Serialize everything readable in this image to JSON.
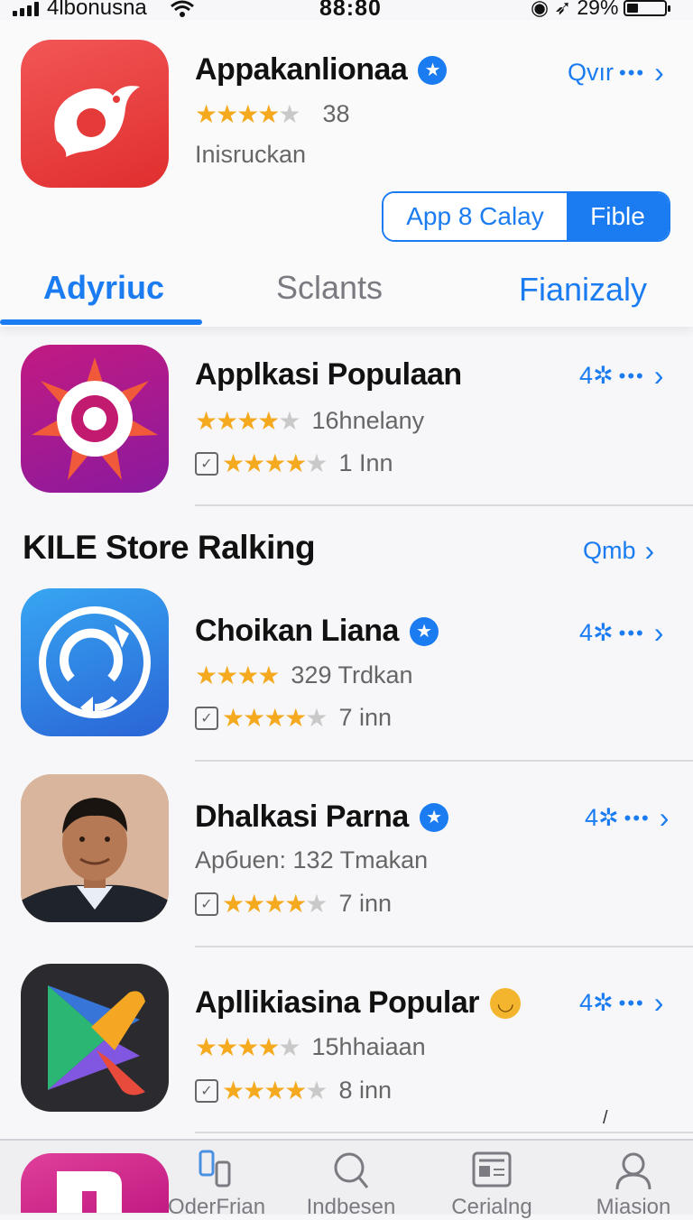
{
  "status_bar": {
    "carrier": "4lbonusna",
    "time": "88:80",
    "battery": "29%",
    "battery_level": 0.29
  },
  "featured_app": {
    "name": "Appakanlionaa",
    "rating_count": "38",
    "category": "Inisruckan",
    "more_label": "Qvır",
    "icon": "bird-logo-icon",
    "icon_color": "#ea3b3b",
    "segment": {
      "left_label": "App 8 Calay",
      "right_label": "Fible"
    }
  },
  "tabs": [
    {
      "label": "Adyriuc",
      "active": true
    },
    {
      "label": "Sclants",
      "active": false
    },
    {
      "label": "Fianizaly",
      "active": false
    }
  ],
  "popular_app": {
    "name": "Applkasi Populaan",
    "rating_text": "16hnelany",
    "size_text": "1 Inn",
    "more_label": "4✲",
    "icon": "target-star-icon"
  },
  "section": {
    "title": "KILE Store Ralking",
    "more_label": "Qmb"
  },
  "ranking": [
    {
      "name": "Choikan Liana",
      "rating_text": "329 Trdkan",
      "size_text": "7 inn",
      "more_label": "4✲",
      "icon": "sync-arrows-icon",
      "verified": true
    },
    {
      "name": "Dhalkasi Parna",
      "rating_text": "Apбuen: 132 Tmakan",
      "size_text": "7 inn",
      "more_label": "4✲",
      "icon": "person-photo-icon",
      "verified": true
    },
    {
      "name": "Apllikiasina Popular",
      "rating_text": "15hhaiaan",
      "size_text": "8 inn",
      "more_label": "4✲",
      "icon": "play-triangle-icon",
      "verified": false
    }
  ],
  "tab_bar": [
    {
      "label": "OderFrian",
      "icon": "phone-swap-icon"
    },
    {
      "label": "Indbesen",
      "icon": "search-icon"
    },
    {
      "label": "Cerialng",
      "icon": "news-icon"
    },
    {
      "label": "Miasion",
      "icon": "person-icon"
    }
  ],
  "colors": {
    "accent": "#1b7cf2",
    "star": "#f4a91e"
  }
}
